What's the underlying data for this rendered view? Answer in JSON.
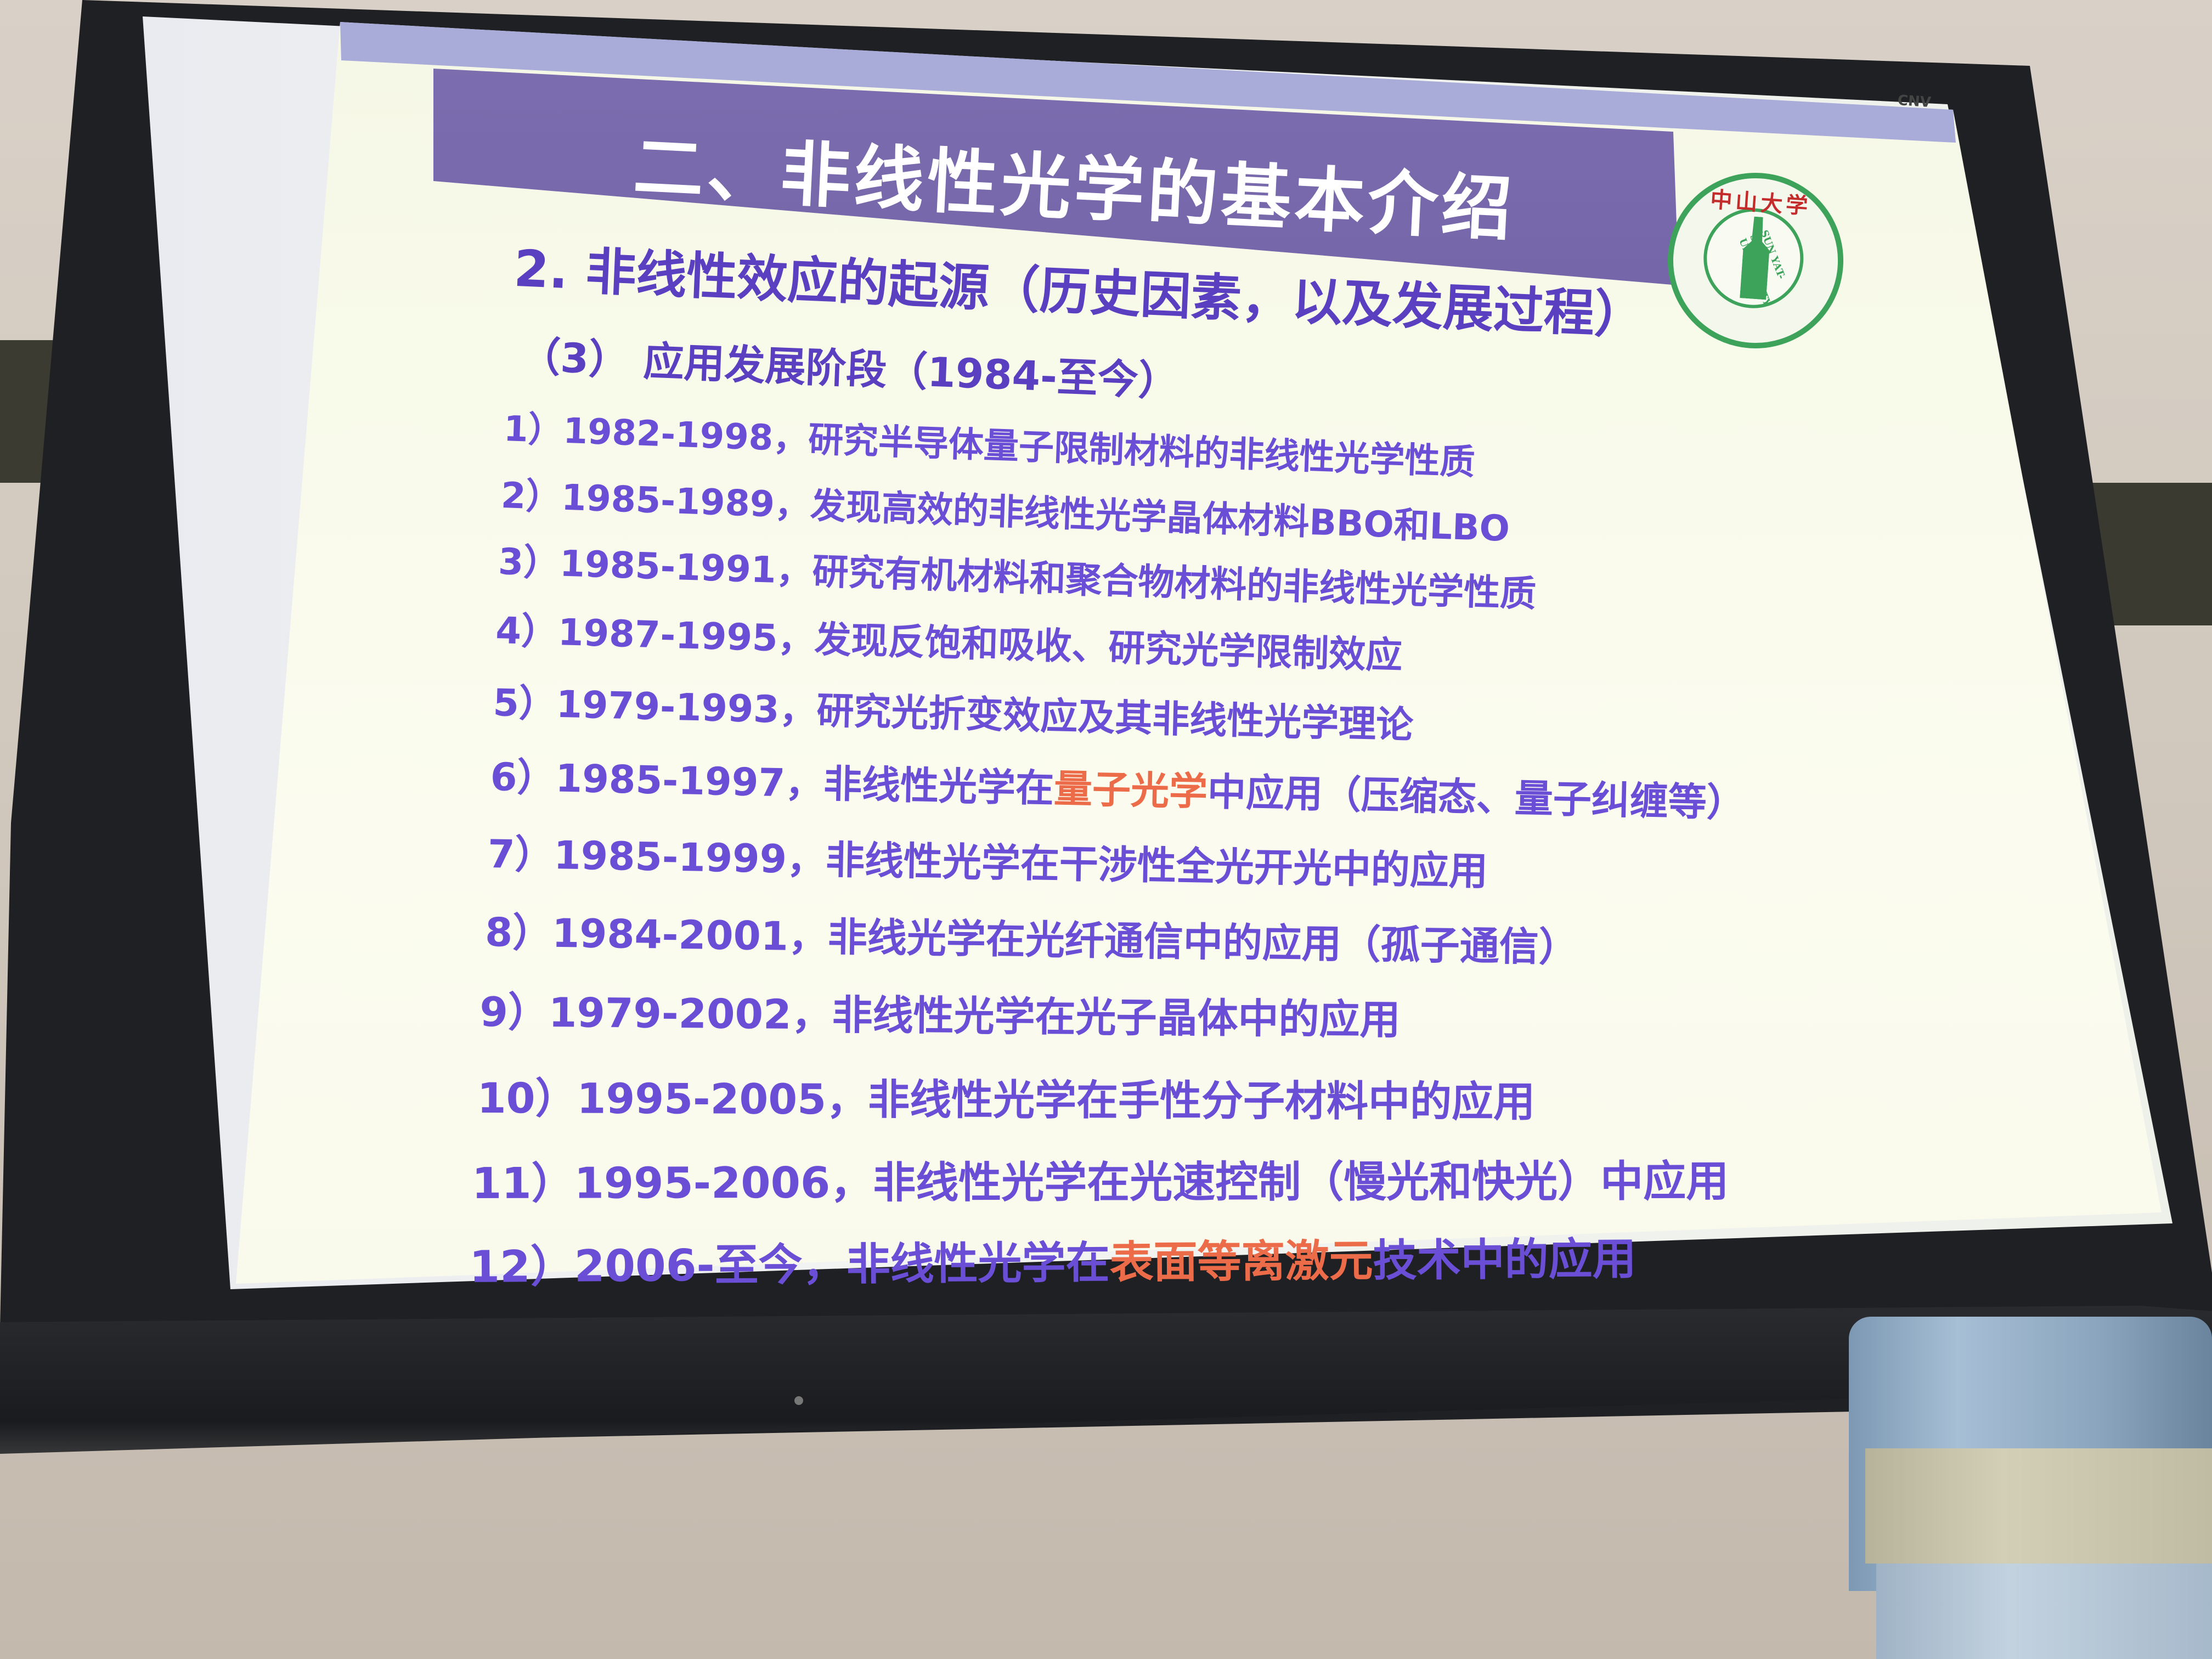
{
  "slide": {
    "title": "二、非线性光学的基本介绍",
    "subtitle": "2. 非线性效应的起源（历史因素，以及发展过程）",
    "section": "（3） 应用发展阶段（1984-至今）",
    "items": [
      {
        "pre": "1）1982-1998，研究半导体量子限制材料的非线性光学性质",
        "hl": "",
        "post": ""
      },
      {
        "pre": "2）1985-1989，发现高效的非线性光学晶体材料BBO和LBO",
        "hl": "",
        "post": ""
      },
      {
        "pre": "3）1985-1991，研究有机材料和聚合物材料的非线性光学性质",
        "hl": "",
        "post": ""
      },
      {
        "pre": "4）1987-1995，发现反饱和吸收、研究光学限制效应",
        "hl": "",
        "post": ""
      },
      {
        "pre": "5）1979-1993，研究光折变效应及其非线性光学理论",
        "hl": "",
        "post": ""
      },
      {
        "pre": "6）1985-1997，非线性光学在",
        "hl": "量子光学",
        "post": "中应用（压缩态、量子纠缠等）"
      },
      {
        "pre": "7）1985-1999，非线性光学在干涉性全光开光中的应用",
        "hl": "",
        "post": ""
      },
      {
        "pre": "8）1984-2001，非线光学在光纤通信中的应用（孤子通信）",
        "hl": "",
        "post": ""
      },
      {
        "pre": "9）1979-2002，非线性光学在光子晶体中的应用",
        "hl": "",
        "post": ""
      },
      {
        "pre": "10）1995-2005，非线性光学在手性分子材料中的应用",
        "hl": "",
        "post": ""
      },
      {
        "pre": "11）1995-2006，非线性光学在光速控制（慢光和快光）中应用",
        "hl": "",
        "post": ""
      },
      {
        "pre": "12）2006-至今，非线性光学在",
        "hl": "表面等离激元",
        "post": "技术中的应用"
      }
    ],
    "logo": {
      "top_text": "中山大学",
      "ring_text": "SUN YAT-SEN UNIVERSITY"
    }
  },
  "scene": {
    "screen_brand": "CNV"
  }
}
